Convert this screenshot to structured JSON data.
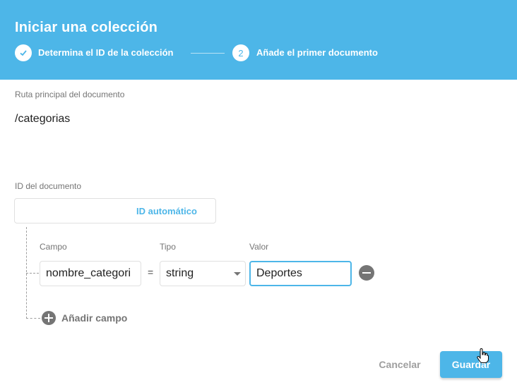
{
  "dialog": {
    "title": "Iniciar una colección",
    "steps": [
      {
        "marker": "check-icon",
        "label": "Determina el ID de la colección"
      },
      {
        "marker": "2",
        "label": "Añade el primer documento"
      }
    ]
  },
  "parent_path": {
    "label": "Ruta principal del documento",
    "value": "/categorias"
  },
  "document_id": {
    "label": "ID del documento",
    "auto_id_button": "ID automático"
  },
  "fields": {
    "headers": {
      "field": "Campo",
      "type": "Tipo",
      "value": "Valor"
    },
    "rows": [
      {
        "field": "nombre_categori",
        "equals": "=",
        "type": "string",
        "value": "Deportes"
      }
    ],
    "add_field_label": "Añadir campo"
  },
  "footer": {
    "cancel_label": "Cancelar",
    "save_label": "Guardar"
  },
  "colors": {
    "accent": "#4db6e8",
    "icon_gray": "#757575"
  }
}
